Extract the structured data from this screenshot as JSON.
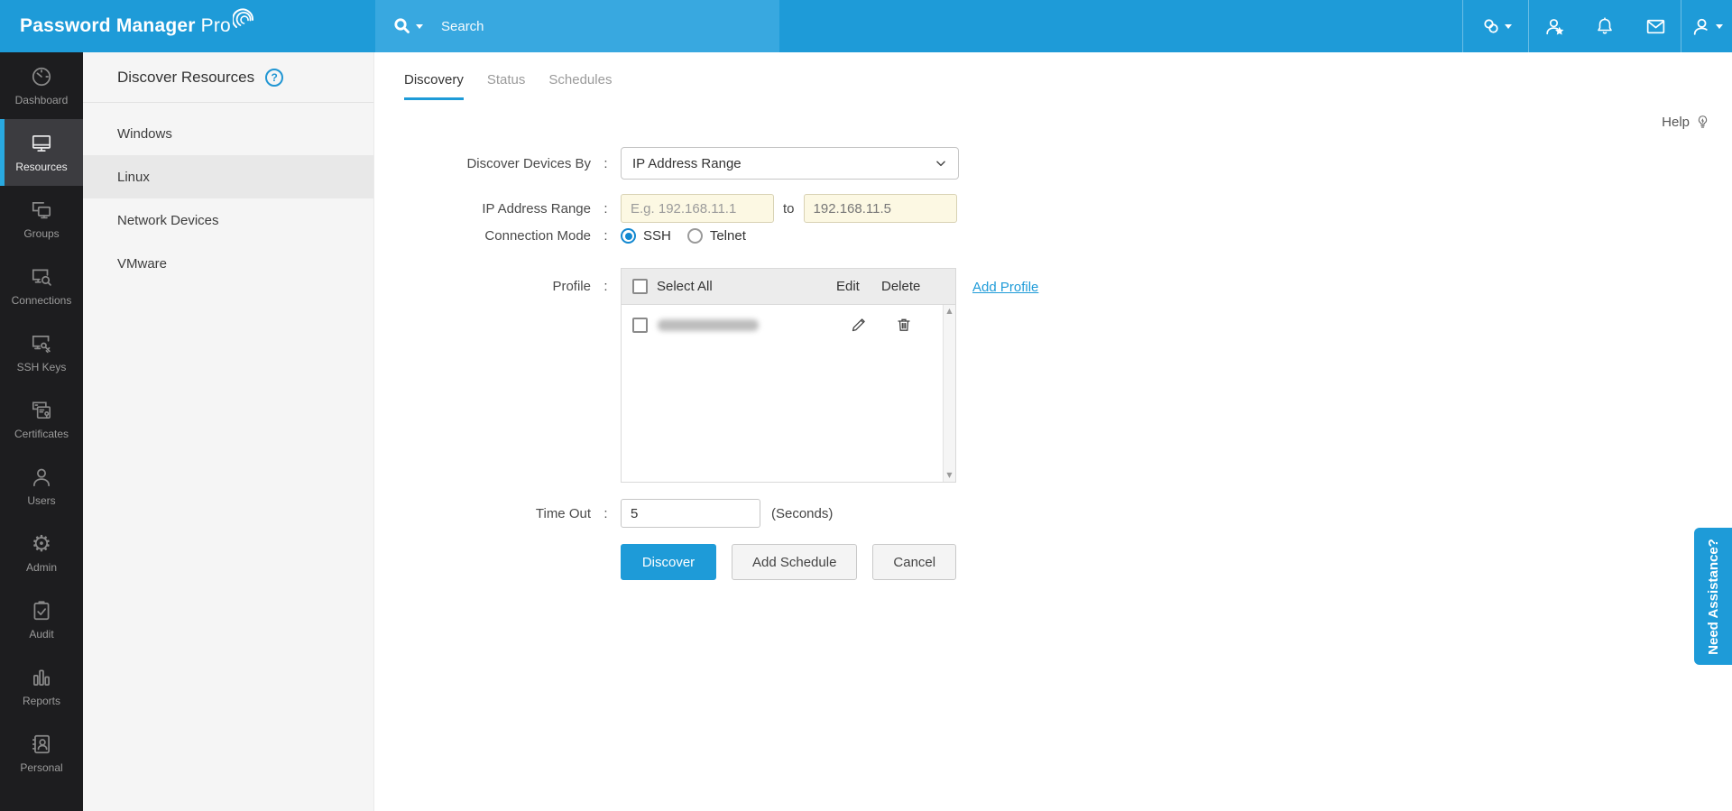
{
  "topbar": {
    "logo_bold": "Password Manager",
    "logo_light": "Pro",
    "search_placeholder": "Search",
    "icons": [
      "resource-link-icon",
      "approver-user-star-icon",
      "notifications-bell-icon",
      "mail-icon",
      "account-user-icon"
    ]
  },
  "sidebar": {
    "items": [
      {
        "label": "Dashboard",
        "icon": "gauge-icon",
        "active": false
      },
      {
        "label": "Resources",
        "icon": "monitor-icon",
        "active": true
      },
      {
        "label": "Groups",
        "icon": "group-monitors-icon",
        "active": false
      },
      {
        "label": "Connections",
        "icon": "connections-icon",
        "active": false
      },
      {
        "label": "SSH Keys",
        "icon": "ssh-keys-icon",
        "active": false
      },
      {
        "label": "Certificates",
        "icon": "certificates-icon",
        "active": false
      },
      {
        "label": "Users",
        "icon": "user-icon",
        "active": false
      },
      {
        "label": "Admin",
        "icon": "gear-icon",
        "active": false
      },
      {
        "label": "Audit",
        "icon": "clipboard-check-icon",
        "active": false
      },
      {
        "label": "Reports",
        "icon": "bar-chart-icon",
        "active": false
      },
      {
        "label": "Personal",
        "icon": "address-book-icon",
        "active": false
      }
    ]
  },
  "subnav": {
    "title": "Discover Resources",
    "help_badge": "?",
    "items": [
      {
        "label": "Windows",
        "active": false
      },
      {
        "label": "Linux",
        "active": true
      },
      {
        "label": "Network Devices",
        "active": false
      },
      {
        "label": "VMware",
        "active": false
      }
    ]
  },
  "main": {
    "tabs": [
      {
        "label": "Discovery",
        "active": true
      },
      {
        "label": "Status",
        "active": false
      },
      {
        "label": "Schedules",
        "active": false
      }
    ],
    "help_label": "Help",
    "form": {
      "colon": ":",
      "discover_by_label": "Discover Devices By",
      "discover_by_value": "IP Address Range",
      "ip_range_label": "IP Address Range",
      "ip_from_placeholder": "E.g. 192.168.11.1",
      "to_label": "to",
      "ip_to_value": "192.168.11.5",
      "connection_mode_label": "Connection Mode",
      "connection_modes": [
        {
          "label": "SSH",
          "selected": true
        },
        {
          "label": "Telnet",
          "selected": false
        }
      ],
      "profile_label": "Profile",
      "profile_table": {
        "select_all_label": "Select All",
        "edit_label": "Edit",
        "delete_label": "Delete",
        "row_count": 1,
        "row_name_redacted": true
      },
      "add_profile_label": "Add Profile",
      "timeout_label": "Time Out",
      "timeout_value": "5",
      "timeout_unit": "(Seconds)"
    },
    "buttons": [
      {
        "label": "Discover",
        "primary": true
      },
      {
        "label": "Add Schedule",
        "primary": false
      },
      {
        "label": "Cancel",
        "primary": false
      }
    ]
  },
  "assistance_label": "Need Assistance?",
  "colors": {
    "topbar": "#1E9BD8",
    "search_bg": "#38A8E0",
    "accent": "#1E9BD8",
    "sidebar_bg": "#1D1D1F",
    "sidebar_active_bg": "#3C3C40",
    "subnav_bg": "#F5F5F5",
    "subnav_active_bg": "#E8E8E8",
    "ip_input_bg": "#FCF8E3",
    "table_header_bg": "#ECECEC"
  }
}
